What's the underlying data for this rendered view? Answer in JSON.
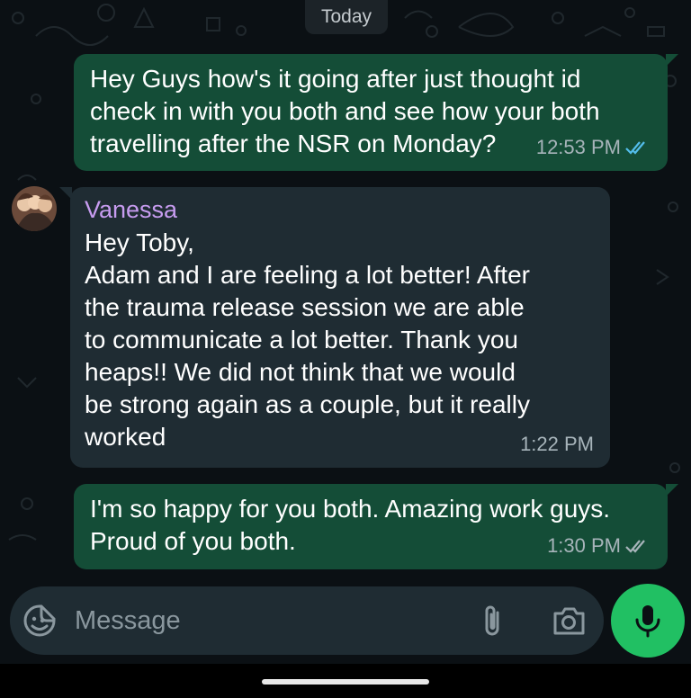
{
  "chat": {
    "date_label": "Today",
    "messages": [
      {
        "direction": "outgoing",
        "text": "Hey Guys how's it going after just thought id\ncheck in with you both and see how your both\ntravelling after the NSR on Monday?",
        "time": "12:53 PM",
        "status": "read"
      },
      {
        "direction": "incoming",
        "sender": "Vanessa",
        "text": "Hey Toby,\nAdam and I are feeling a lot better! After\nthe trauma release session we are able\nto communicate a lot better. Thank you\nheaps!! We did not think that we would\nbe strong again as a couple, but it really\nworked",
        "time": "1:22 PM"
      },
      {
        "direction": "outgoing",
        "text": "I'm so happy for you both. Amazing work guys.\nProud of you both.",
        "time": "1:30 PM",
        "status": "delivered"
      }
    ]
  },
  "composer": {
    "placeholder": "Message",
    "emoji_icon": "sticker-smiley-icon",
    "attach_icon": "paperclip-icon",
    "camera_icon": "camera-icon",
    "mic_icon": "microphone-icon"
  },
  "colors": {
    "background": "#0b1014",
    "outgoing_bubble": "#144d37",
    "incoming_bubble": "#1f2c33",
    "sender_name": "#c79cf0",
    "read_ticks": "#53bdeb",
    "mic_button": "#21c063"
  }
}
